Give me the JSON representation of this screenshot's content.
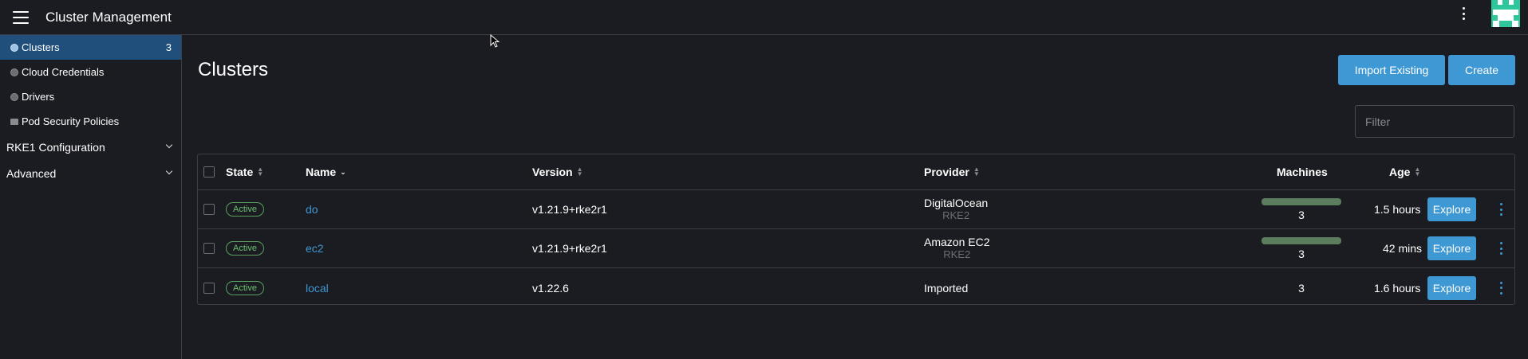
{
  "header": {
    "title": "Cluster Management",
    "menu_icon": "hamburger-icon",
    "more_icon": "kebab-icon",
    "avatar_color": "#2ec79b"
  },
  "sidebar": {
    "items": [
      {
        "label": "Clusters",
        "count": "3",
        "icon": "circle-icon",
        "active": true
      },
      {
        "label": "Cloud Credentials",
        "icon": "circle-icon"
      },
      {
        "label": "Drivers",
        "icon": "circle-icon"
      },
      {
        "label": "Pod Security Policies",
        "icon": "folder-icon"
      }
    ],
    "groups": [
      {
        "label": "RKE1 Configuration"
      },
      {
        "label": "Advanced"
      }
    ]
  },
  "main": {
    "title": "Clusters",
    "import_label": "Import Existing",
    "create_label": "Create",
    "filter_placeholder": "Filter"
  },
  "table": {
    "columns": {
      "state": "State",
      "name": "Name",
      "version": "Version",
      "provider": "Provider",
      "machines": "Machines",
      "age": "Age"
    },
    "rows": [
      {
        "state": "Active",
        "name": "do",
        "version": "v1.21.9+rke2r1",
        "provider": "DigitalOcean",
        "provider_sub": "RKE2",
        "machines": "3",
        "age": "1.5 hours",
        "action": "Explore"
      },
      {
        "state": "Active",
        "name": "ec2",
        "version": "v1.21.9+rke2r1",
        "provider": "Amazon EC2",
        "provider_sub": "RKE2",
        "machines": "3",
        "age": "42 mins",
        "action": "Explore"
      },
      {
        "state": "Active",
        "name": "local",
        "version": "v1.22.6",
        "provider": "Imported",
        "provider_sub": "",
        "machines": "3",
        "age": "1.6 hours",
        "action": "Explore"
      }
    ]
  },
  "colors": {
    "accent": "#3d98d3",
    "active_nav": "#1f4f7a",
    "status_active": "#6cc070"
  }
}
